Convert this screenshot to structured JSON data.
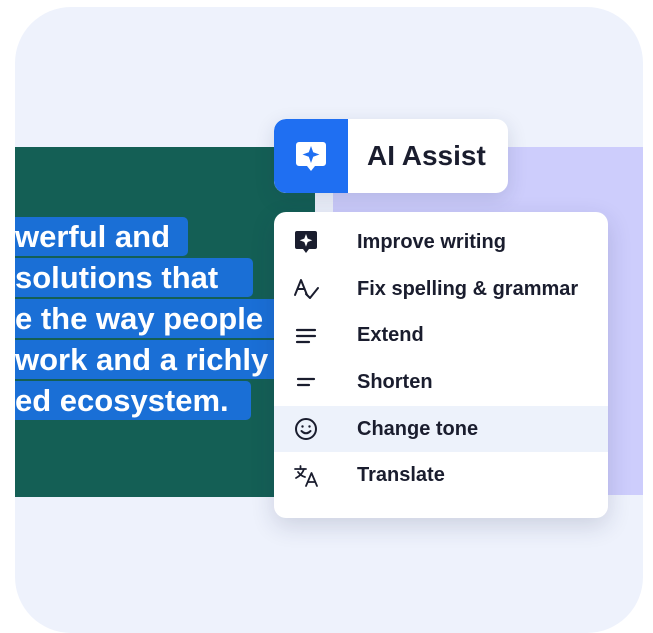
{
  "background_text": {
    "lines": [
      "werful and",
      "solutions that",
      "e the way people",
      "work and a richly",
      "ed ecosystem."
    ]
  },
  "ai_assist": {
    "label": "AI Assist",
    "icon": "sparkle-icon"
  },
  "menu": {
    "items": [
      {
        "label": "Improve writing",
        "icon": "sparkle-badge-icon"
      },
      {
        "label": "Fix spelling & grammar",
        "icon": "spellcheck-icon"
      },
      {
        "label": "Extend",
        "icon": "extend-lines-icon"
      },
      {
        "label": "Shorten",
        "icon": "shorten-lines-icon"
      },
      {
        "label": "Change tone",
        "icon": "smiley-icon",
        "highlighted": true
      },
      {
        "label": "Translate",
        "icon": "translate-icon"
      }
    ]
  },
  "colors": {
    "accent": "#1f6ff2",
    "panel_green": "#145f55",
    "panel_lavender": "#cdcdfc",
    "text_highlight": "#1a6fd6",
    "card_bg": "#eef2fc"
  }
}
